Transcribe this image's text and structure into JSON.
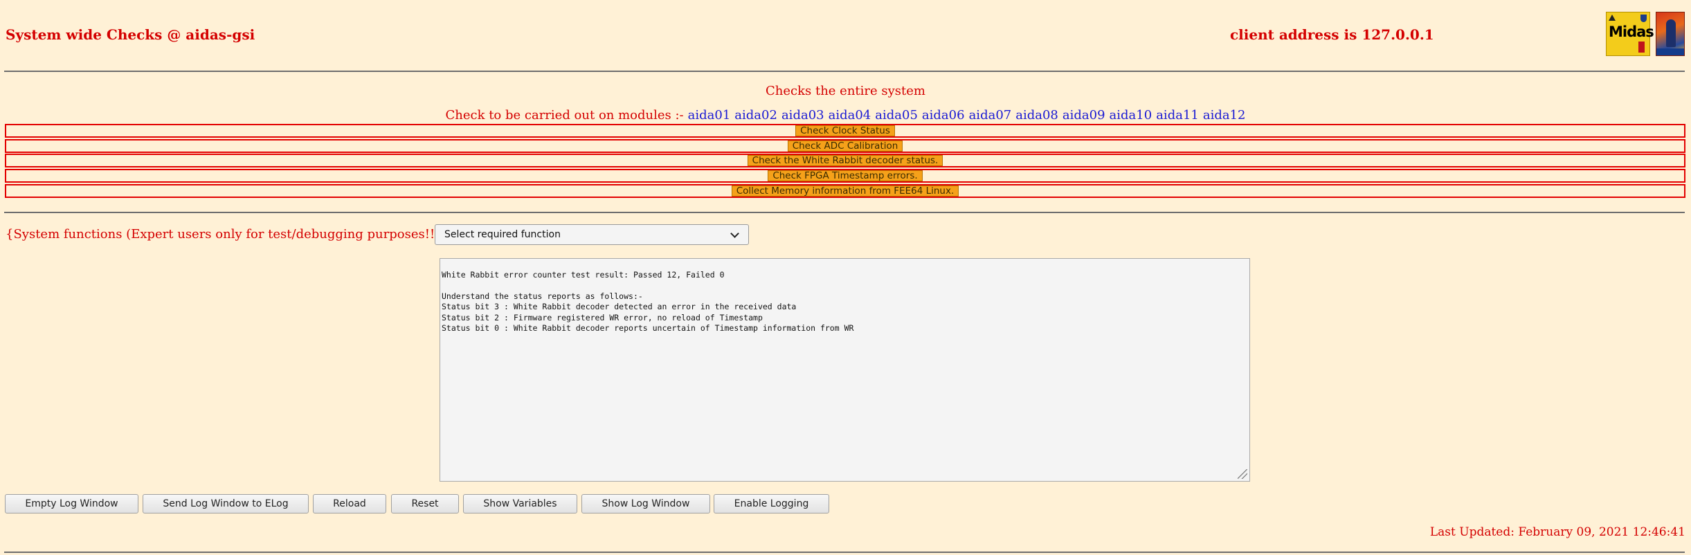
{
  "header": {
    "title": "System wide Checks @ aidas-gsi",
    "client_address": "client address is 127.0.0.1",
    "logo_midas_text": "Midas"
  },
  "subtitle": "Checks the entire system",
  "modules": {
    "label": "Check to be carried out on modules :-",
    "items": [
      "aida01",
      "aida02",
      "aida03",
      "aida04",
      "aida05",
      "aida06",
      "aida07",
      "aida08",
      "aida09",
      "aida10",
      "aida11",
      "aida12"
    ]
  },
  "checks": [
    "Check Clock Status",
    "Check ADC Calibration",
    "Check the White Rabbit decoder status.",
    "Check FPGA Timestamp errors.",
    "Collect Memory information from FEE64 Linux."
  ],
  "system_functions": {
    "label": "{System functions (Expert users only for test/debugging purposes!!!)  } {",
    "select_value": "Select required function"
  },
  "log": {
    "lines": [
      "White Rabbit error counter test result: Passed 12, Failed 0",
      "",
      "Understand the status reports as follows:-",
      "Status bit 3 : White Rabbit decoder detected an error in the received data",
      "Status bit 2 : Firmware registered WR error, no reload of Timestamp",
      "Status bit 0 : White Rabbit decoder reports uncertain of Timestamp information from WR"
    ]
  },
  "buttons": {
    "empty_log": "Empty Log Window",
    "send_log": "Send Log Window to ELog",
    "reload": "Reload",
    "reset": "Reset",
    "show_variables": "Show Variables",
    "show_log": "Show Log Window",
    "enable_logging": "Enable Logging"
  },
  "last_updated": "Last Updated: February 09, 2021 12:46:41",
  "colors": {
    "background": "#fff1d6",
    "text_red": "#d40000",
    "link_blue": "#1a1ad4",
    "check_button": "#f5a11a"
  }
}
